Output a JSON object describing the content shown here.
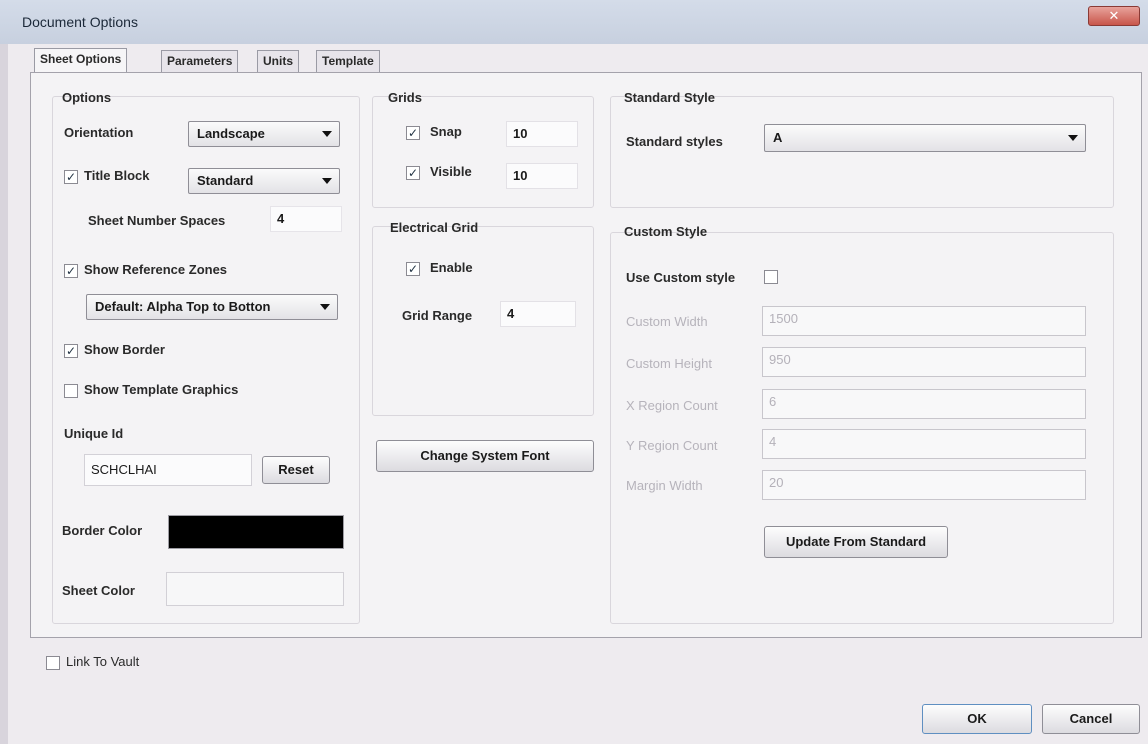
{
  "window": {
    "title": "Document Options",
    "close_glyph": "✕"
  },
  "tabs": [
    "Sheet Options",
    "Parameters",
    "Units",
    "Template"
  ],
  "options": {
    "heading": "Options",
    "orientation_label": "Orientation",
    "orientation_value": "Landscape",
    "title_block_label": "Title Block",
    "title_block_checked": true,
    "title_block_value": "Standard",
    "sheet_number_spaces_label": "Sheet Number Spaces",
    "sheet_number_spaces_value": "4",
    "show_reference_zones_label": "Show Reference Zones",
    "show_reference_zones_checked": true,
    "reference_zone_style": "Default: Alpha Top to Botton",
    "show_border_label": "Show Border",
    "show_border_checked": true,
    "show_template_graphics_label": "Show Template Graphics",
    "show_template_graphics_checked": false,
    "unique_id_label": "Unique Id",
    "unique_id_value": "SCHCLHAI",
    "reset_label": "Reset",
    "border_color_label": "Border Color",
    "border_color": "#000000",
    "sheet_color_label": "Sheet Color",
    "sheet_color": "#f7f7f8"
  },
  "grids": {
    "heading": "Grids",
    "snap_label": "Snap",
    "snap_checked": true,
    "snap_value": "10",
    "visible_label": "Visible",
    "visible_checked": true,
    "visible_value": "10"
  },
  "electrical_grid": {
    "heading": "Electrical Grid",
    "enable_label": "Enable",
    "enable_checked": true,
    "grid_range_label": "Grid Range",
    "grid_range_value": "4"
  },
  "change_system_font_label": "Change System Font",
  "standard_style": {
    "heading": "Standard Style",
    "styles_label": "Standard styles",
    "styles_value": "A"
  },
  "custom_style": {
    "heading": "Custom Style",
    "use_custom_label": "Use Custom style",
    "use_custom_checked": false,
    "custom_width_label": "Custom Width",
    "custom_width_value": "1500",
    "custom_height_label": "Custom Height",
    "custom_height_value": "950",
    "x_region_label": "X Region Count",
    "x_region_value": "6",
    "y_region_label": "Y Region Count",
    "y_region_value": "4",
    "margin_width_label": "Margin Width",
    "margin_width_value": "20",
    "update_label": "Update From Standard"
  },
  "link_to_vault_label": "Link To Vault",
  "link_to_vault_checked": false,
  "ok_label": "OK",
  "cancel_label": "Cancel"
}
